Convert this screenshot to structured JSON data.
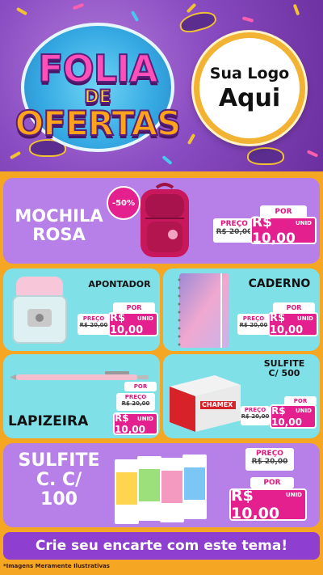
{
  "header": {
    "title_line1": "FOLIA",
    "title_line2": "DE",
    "title_line3": "OFERTAS",
    "logo_line1": "Sua Logo",
    "logo_line2": "Aqui"
  },
  "products": [
    {
      "name_l1": "MOCHILA",
      "name_l2": "ROSA",
      "discount": "-50%",
      "old_label": "PREÇO",
      "old_price": "R$ 20,00",
      "por": "POR",
      "new_price": "R$ 10,00",
      "unit": "UNID"
    },
    {
      "name_l1": "APONTADOR",
      "old_label": "PREÇO",
      "old_price": "R$ 20,00",
      "por": "POR",
      "new_price": "R$ 10,00",
      "unit": "UNID"
    },
    {
      "name_l1": "CADERNO",
      "old_label": "PREÇO",
      "old_price": "R$ 20,00",
      "por": "POR",
      "new_price": "R$ 10,00",
      "unit": "UNID"
    },
    {
      "name_l1": "LAPIZEIRA",
      "old_label": "PREÇO",
      "old_price": "R$ 20,00",
      "por": "POR",
      "new_price": "R$ 10,00",
      "unit": "UNID"
    },
    {
      "name_l1": "SULFITE",
      "name_l2": "C/ 500",
      "old_label": "PREÇO",
      "old_price": "R$ 20,00",
      "por": "POR",
      "new_price": "R$ 10,00",
      "unit": "UNID",
      "box_brand": "CHAMEX"
    },
    {
      "name_l1": "SULFITE",
      "name_l2": "C. C/",
      "name_l3": "100",
      "old_label": "PREÇO",
      "old_price": "R$ 20,00",
      "por": "POR",
      "new_price": "R$ 10,00",
      "unit": "UNID"
    }
  ],
  "footer": {
    "cta": "Crie seu encarte com este tema!",
    "disclaimer": "*Imagens Meramente Ilustrativas"
  },
  "colors": {
    "purple_card": "#b780e8",
    "teal_card": "#7fe0e8",
    "accent_pink": "#e4208f",
    "frame_orange": "#f5a623"
  }
}
